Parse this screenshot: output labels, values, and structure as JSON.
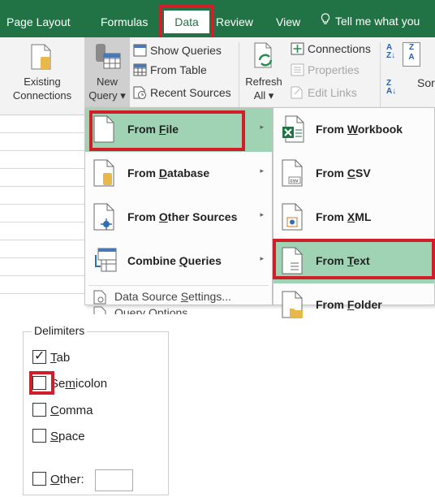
{
  "ribbon_tabs": {
    "page_layout": "Page Layout",
    "formulas": "Formulas",
    "data": "Data",
    "review": "Review",
    "view": "View",
    "tell_me": "Tell me what you"
  },
  "data_ribbon": {
    "existing_connections": [
      "Existing",
      "Connections"
    ],
    "new_query": [
      "New",
      "Query ▾"
    ],
    "show_queries": "Show Queries",
    "from_table": "From Table",
    "recent_sources": "Recent Sources",
    "refresh_all": [
      "Refresh",
      "All ▾"
    ],
    "connections": "Connections",
    "properties": "Properties",
    "edit_links": "Edit Links",
    "sort": "Sor"
  },
  "new_query_menu": {
    "items": [
      {
        "label_pre": "From ",
        "label_u": "F",
        "label_post": "ile",
        "selected": true
      },
      {
        "label_pre": "From ",
        "label_u": "D",
        "label_post": "atabase",
        "selected": false
      },
      {
        "label_pre": "From ",
        "label_u": "O",
        "label_post": "ther Sources",
        "selected": false
      },
      {
        "label_pre": "Combine ",
        "label_u": "Q",
        "label_post": "ueries",
        "selected": false
      }
    ],
    "data_source_settings": {
      "pre": "Data Source ",
      "u": "S",
      "post": "ettings..."
    },
    "query_options": "Query Options"
  },
  "from_file_submenu": {
    "items": [
      {
        "label_pre": "From ",
        "label_u": "W",
        "label_post": "orkbook",
        "selected": false
      },
      {
        "label_pre": "From ",
        "label_u": "C",
        "label_post": "SV",
        "selected": false
      },
      {
        "label_pre": "From ",
        "label_u": "X",
        "label_post": "ML",
        "selected": false
      },
      {
        "label_pre": "From ",
        "label_u": "T",
        "label_post": "ext",
        "selected": true
      },
      {
        "label_pre": "From ",
        "label_u": "F",
        "label_post": "older",
        "selected": false
      }
    ]
  },
  "delimiters": {
    "title": "Delimiters",
    "options": [
      {
        "pre": "",
        "u": "T",
        "post": "ab",
        "checked": true
      },
      {
        "pre": "Se",
        "u": "m",
        "post": "icolon",
        "checked": false
      },
      {
        "pre": "",
        "u": "C",
        "post": "omma",
        "checked": false
      },
      {
        "pre": "",
        "u": "S",
        "post": "pace",
        "checked": false
      },
      {
        "pre": "",
        "u": "O",
        "post": "ther:",
        "checked": false
      }
    ],
    "other_value": ""
  },
  "colors": {
    "excel_green": "#217346",
    "menu_highlight": "#a0d3b4",
    "annotation_red": "#d11f2a"
  }
}
